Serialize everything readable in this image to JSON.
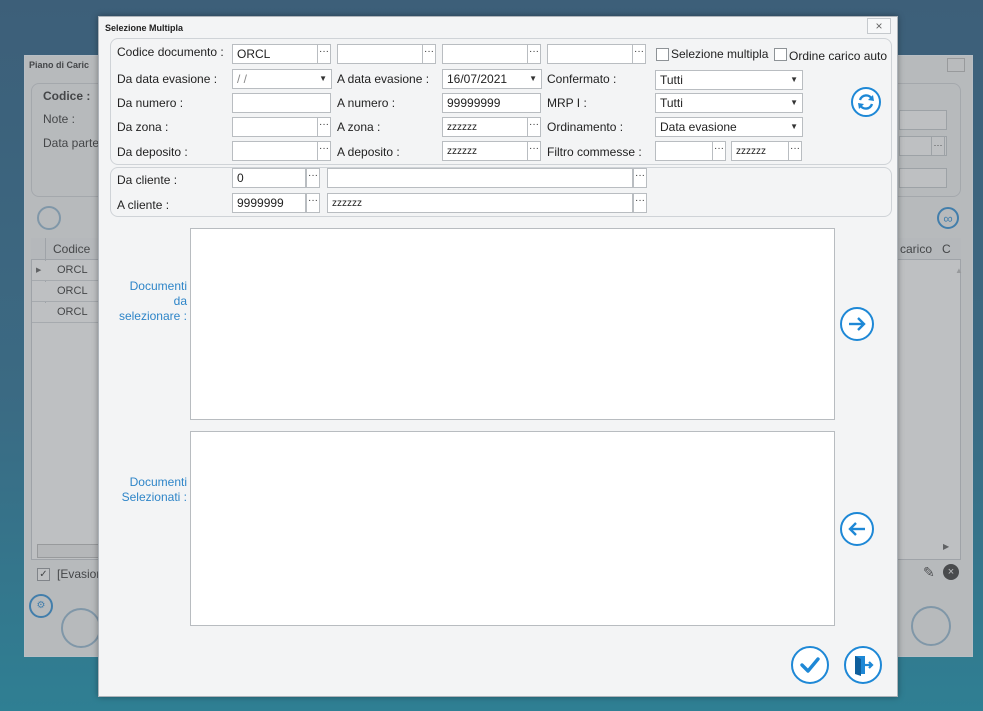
{
  "background_window": {
    "title": "Piano di Caric",
    "codice_label": "Codice :",
    "note_label": "Note :",
    "data_parte_label": "Data parte",
    "table_header": "Codice",
    "rows": [
      "ORCL",
      "ORCL",
      "ORCL"
    ],
    "right_header": "carico",
    "right_header_extra": "C",
    "evasione_label": "[Evasion",
    "evasione_checked": true
  },
  "dialog": {
    "title": "Selezione Multipla",
    "close_glyph": "×",
    "ellipsis": "···",
    "dropdown_arrow": "▼",
    "codice_documento": {
      "label": "Codice documento :",
      "values": [
        "ORCL",
        "",
        "",
        ""
      ]
    },
    "selezione_multipla": {
      "label": "Selezione multipla",
      "checked": false
    },
    "ordine_carico_auto": {
      "label": "Ordine carico auto",
      "checked": false
    },
    "da_data_evasione": {
      "label": "Da data evasione :",
      "value": " /  /"
    },
    "a_data_evasione": {
      "label": "A data evasione :",
      "value": "16/07/2021"
    },
    "confermato": {
      "label": "Confermato :",
      "value": "Tutti"
    },
    "da_numero": {
      "label": "Da numero :",
      "value": ""
    },
    "a_numero": {
      "label": "A numero :",
      "value": "99999999"
    },
    "mrp": {
      "label": "MRP I :",
      "value": "Tutti"
    },
    "da_zona": {
      "label": "Da zona :",
      "value": ""
    },
    "a_zona": {
      "label": "A zona :",
      "value": "zzzzzz"
    },
    "ordinamento": {
      "label": "Ordinamento :",
      "value": "Data evasione"
    },
    "da_deposito": {
      "label": "Da deposito :",
      "value": ""
    },
    "a_deposito": {
      "label": "A deposito :",
      "value": "zzzzzz"
    },
    "filtro_commesse": {
      "label": "Filtro commesse :",
      "from": "",
      "to": "zzzzzz"
    },
    "da_cliente": {
      "label": "Da cliente :",
      "code": "0",
      "name": ""
    },
    "a_cliente": {
      "label": "A cliente :",
      "code": "9999999",
      "name": "zzzzzz"
    },
    "documenti_da_selezionare": {
      "label": "Documenti da selezionare :"
    },
    "documenti_selezionati": {
      "label": "Documenti Selezionati :"
    }
  },
  "colors": {
    "accent": "#1e88d6",
    "label_blue": "#2e85c8"
  },
  "icons": [
    "refresh-icon",
    "arrow-right-icon",
    "arrow-left-icon",
    "confirm-check-icon",
    "exit-door-icon",
    "link-icon",
    "close-icon"
  ]
}
